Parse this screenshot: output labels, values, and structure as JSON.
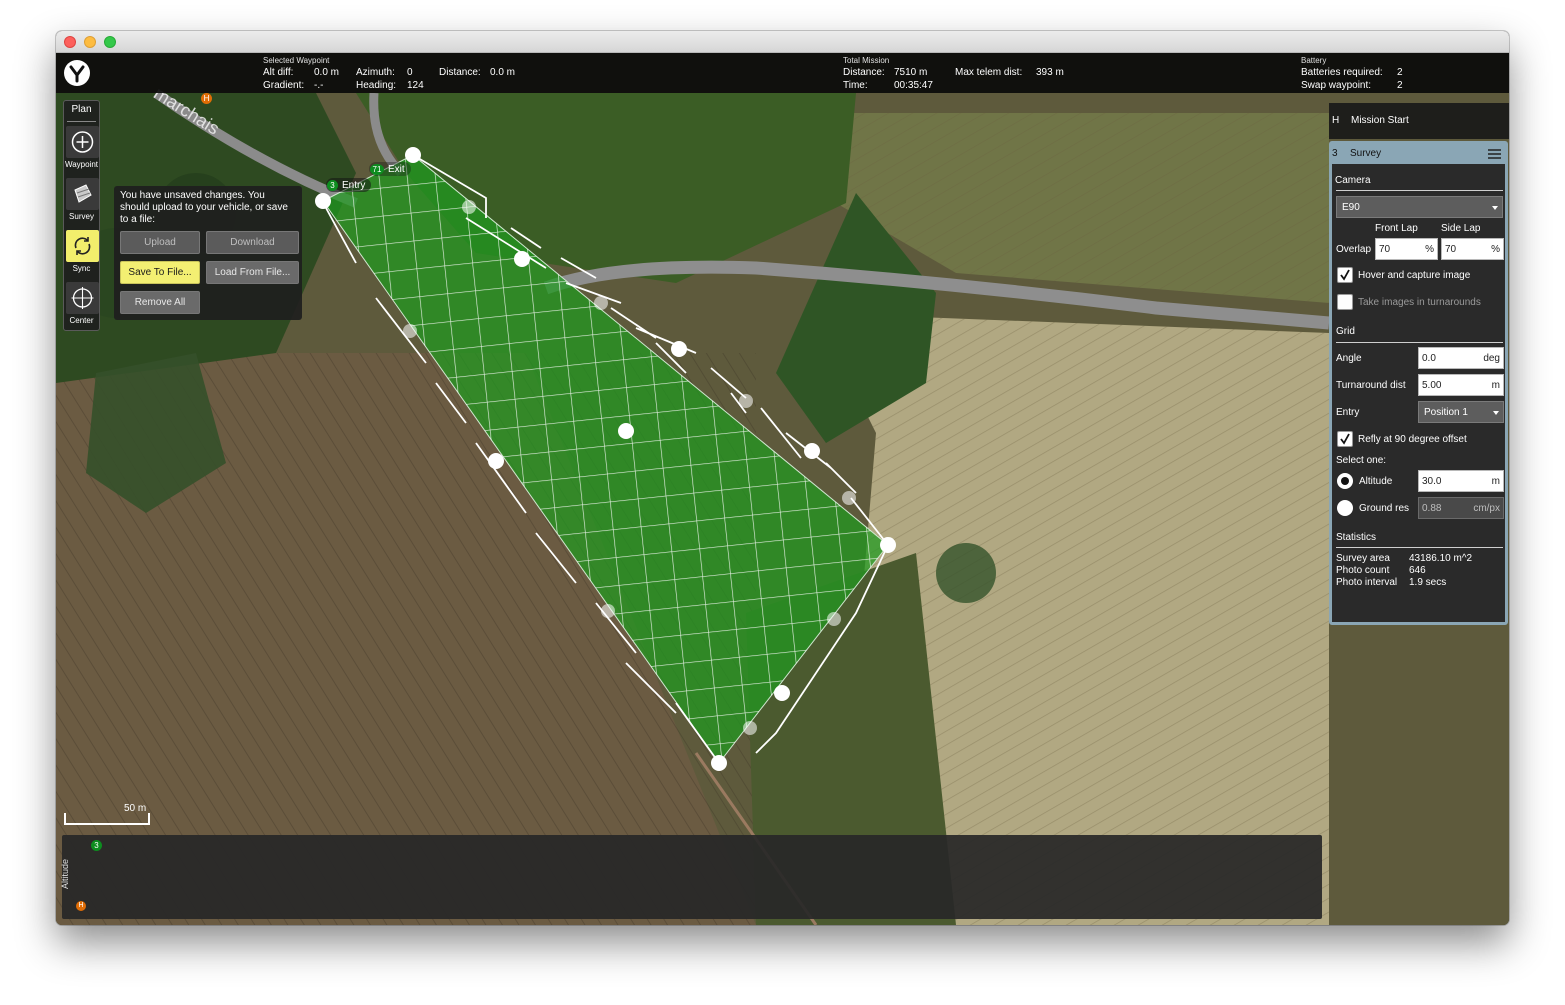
{
  "topbar": {
    "selected_waypoint": {
      "header": "Selected Waypoint",
      "alt_diff_label": "Alt diff:",
      "alt_diff": "0.0 m",
      "azimuth_label": "Azimuth:",
      "azimuth": "0",
      "distance_label": "Distance:",
      "distance": "0.0 m",
      "gradient_label": "Gradient:",
      "gradient": "-.-",
      "heading_label": "Heading:",
      "heading": "124"
    },
    "total_mission": {
      "header": "Total Mission",
      "distance_label": "Distance:",
      "distance": "7510 m",
      "max_telem_label": "Max telem dist:",
      "max_telem": "393 m",
      "time_label": "Time:",
      "time": "00:35:47"
    },
    "battery": {
      "header": "Battery",
      "required_label": "Batteries required:",
      "required": "2",
      "swap_label": "Swap waypoint:",
      "swap": "2"
    }
  },
  "toolbar": {
    "title": "Plan",
    "items": [
      {
        "label": "Waypoint",
        "icon": "plus-circle-icon"
      },
      {
        "label": "Survey",
        "icon": "survey-polygon-icon"
      },
      {
        "label": "Sync",
        "icon": "sync-icon"
      },
      {
        "label": "Center",
        "icon": "crosshair-icon"
      }
    ]
  },
  "unsaved": {
    "message": "You have unsaved changes. You should upload to your vehicle, or save to a file:",
    "upload": "Upload",
    "download": "Download",
    "save_to_file": "Save To File...",
    "load_from_file": "Load From File...",
    "remove_all": "Remove All"
  },
  "map": {
    "road_label": "marchais",
    "home_marker": "H",
    "entry_label": "Entry",
    "entry_number": "3",
    "exit_label": "Exit",
    "exit_number": "71",
    "scale_label": "50 m"
  },
  "altitude_panel": {
    "label": "Altitude",
    "marker_3": "3",
    "marker_h": "H"
  },
  "mission_start": {
    "index": "H",
    "label": "Mission Start"
  },
  "survey": {
    "index": "3",
    "title": "Survey",
    "camera_header": "Camera",
    "camera_value": "E90",
    "front_lap_label": "Front Lap",
    "side_lap_label": "Side Lap",
    "overlap_label": "Overlap",
    "front_lap": "70",
    "side_lap": "70",
    "percent_unit": "%",
    "hover_capture_label": "Hover and capture image",
    "turnaround_images_label": "Take images in turnarounds",
    "grid_header": "Grid",
    "angle_label": "Angle",
    "angle": "0.0",
    "angle_unit": "deg",
    "turnaround_label": "Turnaround dist",
    "turnaround": "5.00",
    "turnaround_unit": "m",
    "entry_label": "Entry",
    "entry_value": "Position 1",
    "refly_label": "Refly at 90 degree offset",
    "select_one": "Select one:",
    "altitude_label": "Altitude",
    "altitude": "30.0",
    "altitude_unit": "m",
    "ground_res_label": "Ground res",
    "ground_res": "0.88",
    "ground_res_unit": "cm/px",
    "statistics_header": "Statistics",
    "survey_area_label": "Survey area",
    "survey_area": "43186.10 m^2",
    "photo_count_label": "Photo count",
    "photo_count": "646",
    "photo_interval_label": "Photo interval",
    "photo_interval": "1.9 secs"
  },
  "colors": {
    "survey_fill": "#1f9a1f",
    "accent_yellow": "#f3ef72",
    "panel_header": "#8aa6b5",
    "entry_badge": "#0d8d1f",
    "home_badge": "#e06d06"
  }
}
